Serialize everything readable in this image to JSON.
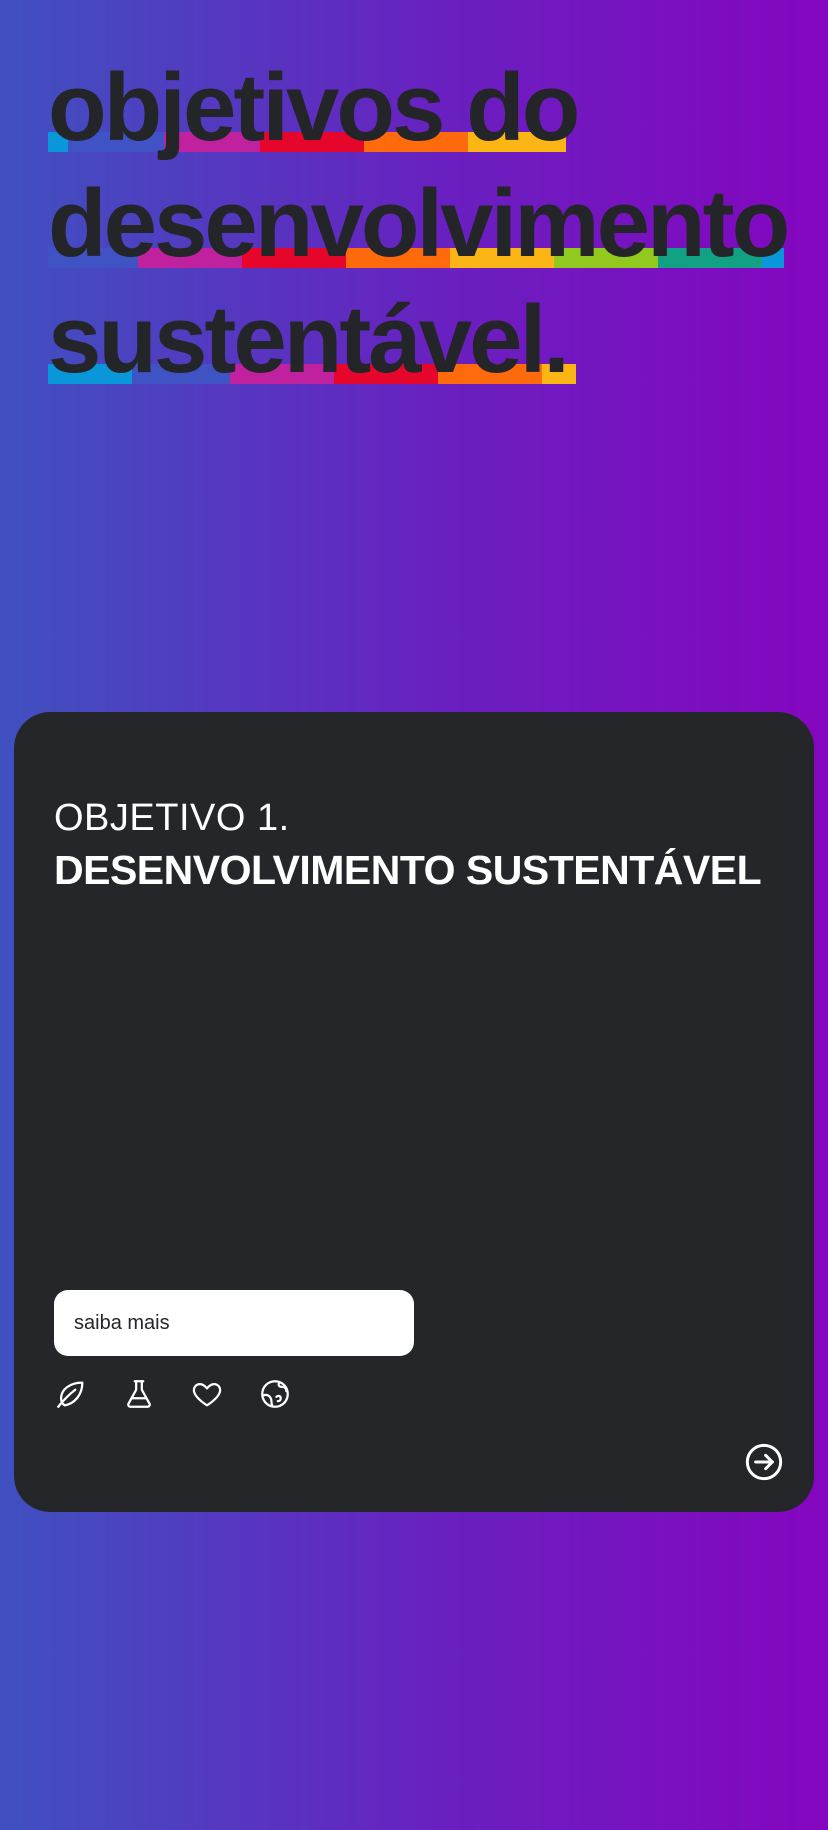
{
  "headline": {
    "lines": [
      "objetivos do",
      "desenvolvimento",
      "sustentável."
    ]
  },
  "palette": {
    "background_start": "#3f51c0",
    "background_end": "#8506bf",
    "card": "#25262a",
    "text_dark": "#242529",
    "stripe_colors": [
      "#0a97d9",
      "#3f53c4",
      "#c0219e",
      "#e6062c",
      "#ff6a0d",
      "#fbb616",
      "#91c91e",
      "#13a183"
    ]
  },
  "card": {
    "label": "OBJETIVO 1.",
    "title": "DESENVOLVIMENTO SUSTENTÁVEL",
    "button_label": "saiba mais",
    "icons": [
      "leaf-icon",
      "flask-icon",
      "heart-icon",
      "globe-icon"
    ],
    "next_icon": "arrow-right-circle-icon"
  }
}
